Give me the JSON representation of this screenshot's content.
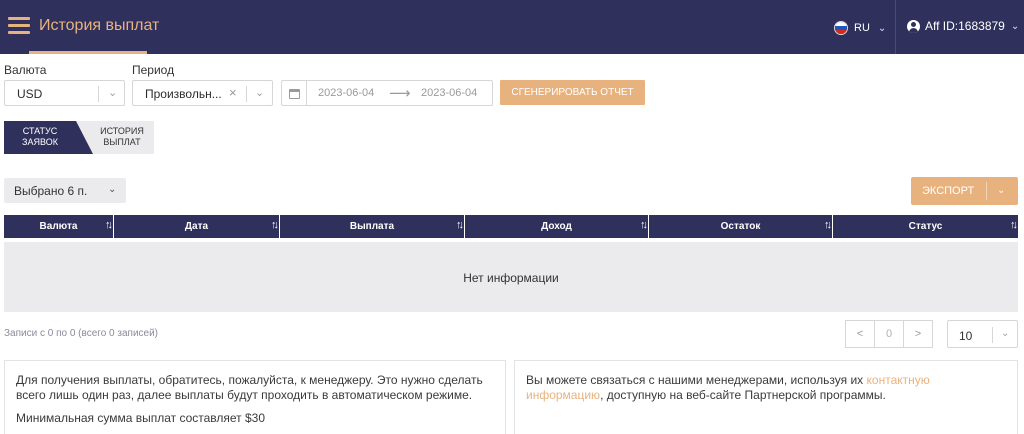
{
  "header": {
    "title": "История выплат",
    "language": "RU",
    "affiliate": "Aff ID:1683879",
    "accent_color": "#e8b27e",
    "bg_color": "#30305d"
  },
  "filters": {
    "currency_label": "Валюта",
    "currency_value": "USD",
    "period_label": "Период",
    "period_value": "Произвольн...",
    "date_from": "2023-06-04",
    "date_to": "2023-06-04",
    "generate_button": "СГЕНЕРИРОВАТЬ ОТЧЕТ"
  },
  "tabs": {
    "status_line1": "СТАТУС",
    "status_line2": "ЗАЯВОК",
    "history_line1": "ИСТОРИЯ",
    "history_line2": "ВЫПЛАТ"
  },
  "toolbar": {
    "selected_label": "Выбрано 6 п.",
    "export_label": "ЭКСПОРТ"
  },
  "table": {
    "columns": [
      "Валюта",
      "Дата",
      "Выплата",
      "Доход",
      "Остаток",
      "Статус"
    ],
    "empty_text": "Нет информации"
  },
  "pagination": {
    "records_text": "Записи с 0 по 0 (всего 0 записей)",
    "prev": "<",
    "page": "0",
    "next": ">",
    "per_page": "10"
  },
  "info": {
    "left_text": "Для получения выплаты, обратитесь, пожалуйста, к менеджеру. Это нужно сделать всего лишь один раз, далее выплаты будут проходить в автоматическом режиме.",
    "left_min": "Минимальная сумма выплат составляет $30",
    "right_before": "Вы можете связаться с нашими менеджерами, используя их ",
    "right_link": "контактную информацию",
    "right_after": ", доступную на веб-сайте Партнерской программы."
  }
}
